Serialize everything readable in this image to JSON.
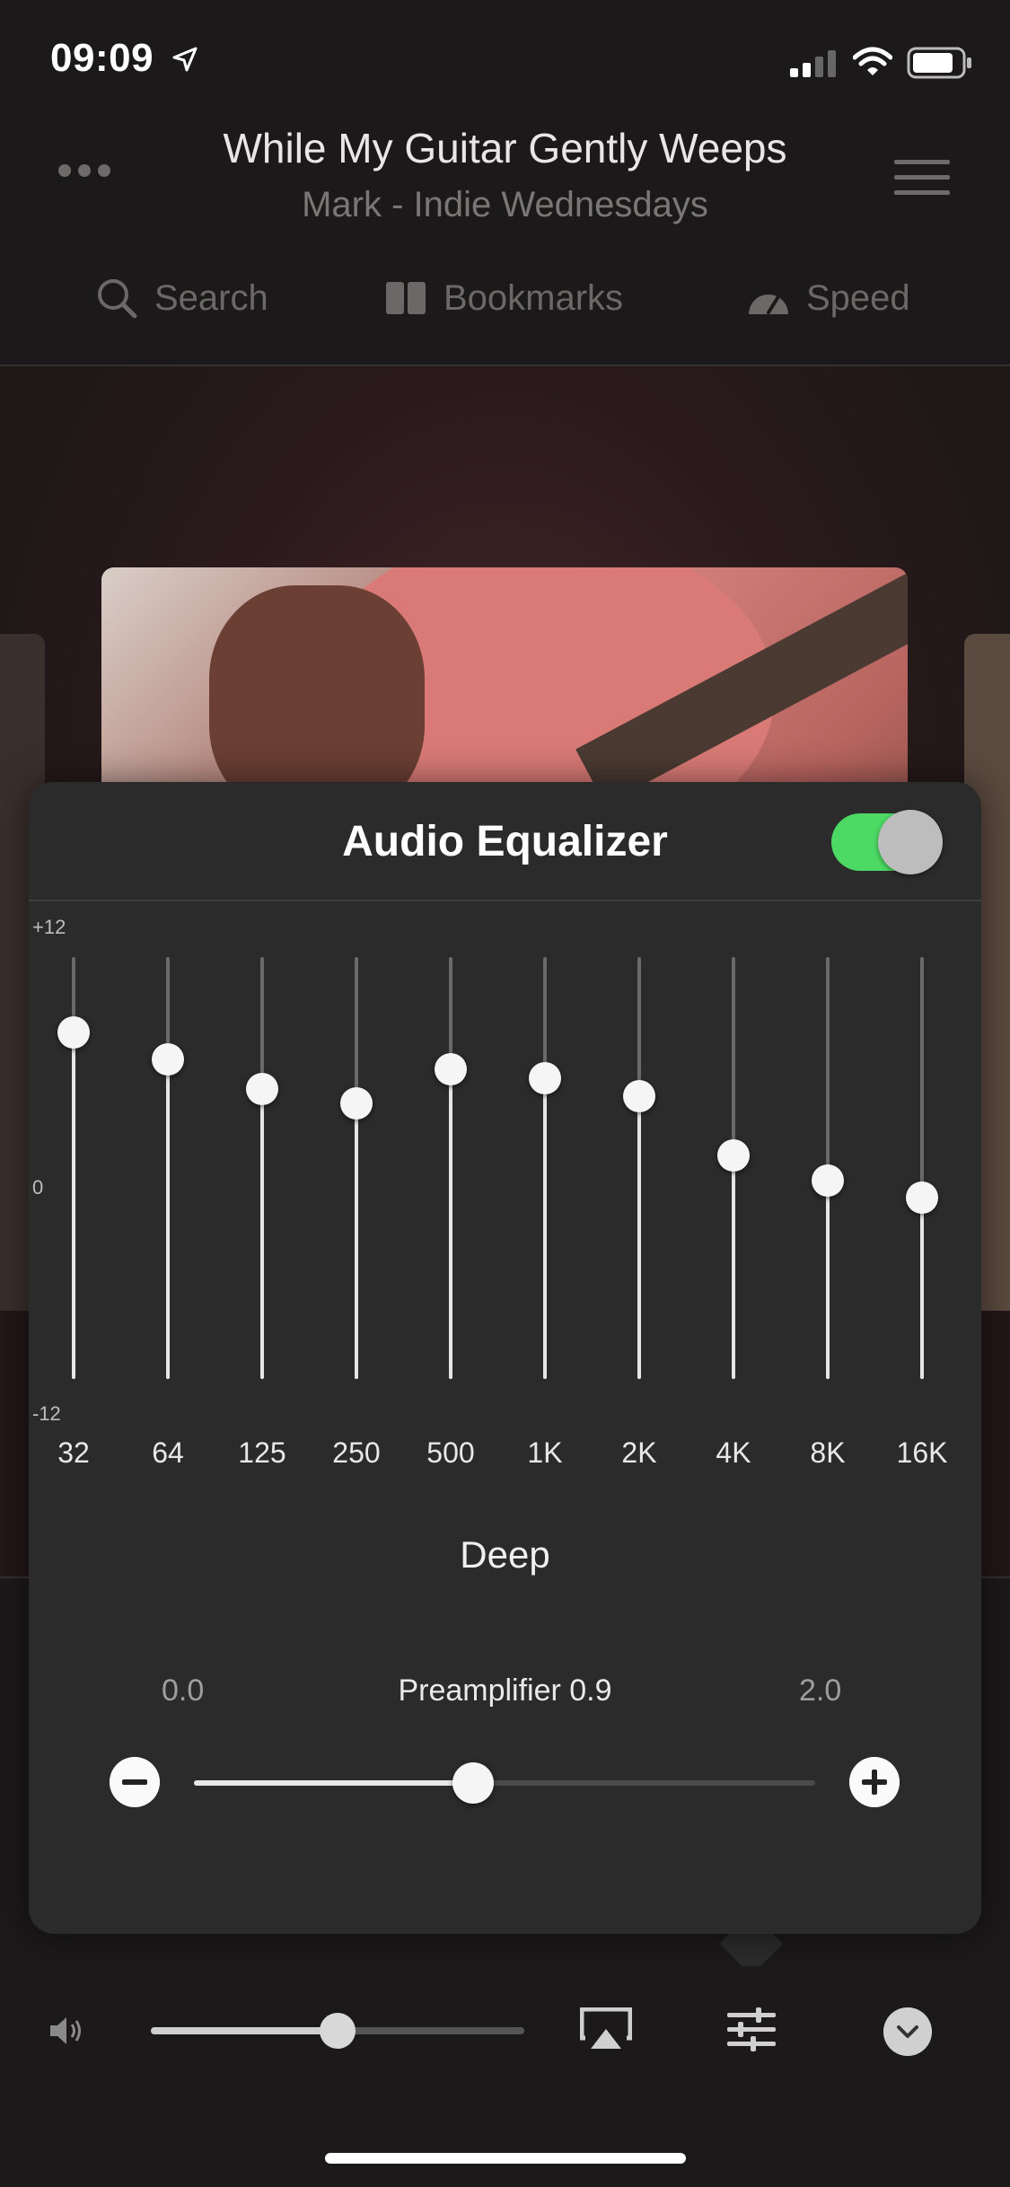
{
  "status_bar": {
    "time": "09:09"
  },
  "header": {
    "title": "While My Guitar Gently Weeps",
    "subtitle": "Mark - Indie Wednesdays"
  },
  "nav": {
    "search": "Search",
    "bookmarks": "Bookmarks",
    "speed": "Speed"
  },
  "equalizer": {
    "title": "Audio Equalizer",
    "enabled": true,
    "axis": {
      "max": "+12",
      "zero": "0",
      "min": "-12"
    },
    "bands": [
      {
        "label": "32",
        "gain": 7.7
      },
      {
        "label": "64",
        "gain": 6.2
      },
      {
        "label": "125",
        "gain": 4.5
      },
      {
        "label": "250",
        "gain": 3.7
      },
      {
        "label": "500",
        "gain": 5.6
      },
      {
        "label": "1K",
        "gain": 5.1
      },
      {
        "label": "2K",
        "gain": 4.1
      },
      {
        "label": "4K",
        "gain": 0.7
      },
      {
        "label": "8K",
        "gain": -0.7
      },
      {
        "label": "16K",
        "gain": -1.7
      }
    ],
    "preset": "Deep",
    "preamp": {
      "min_label": "0.0",
      "max_label": "2.0",
      "label": "Preamplifier 0.9",
      "value": 0.9,
      "max": 2.0
    }
  },
  "player": {
    "volume_fraction": 0.5
  },
  "colors": {
    "toggle_on": "#4cd964",
    "panel_bg": "#2b2b2b"
  }
}
